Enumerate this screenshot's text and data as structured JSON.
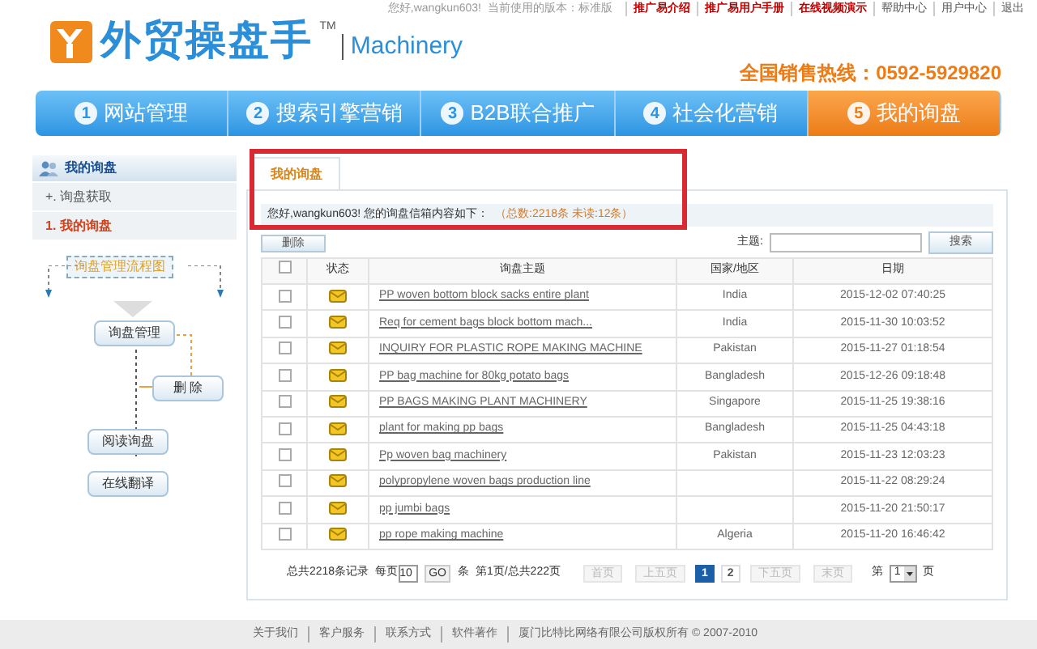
{
  "header": {
    "greeting": "您好,wangkun603!",
    "edition": "当前使用的版本：标准版",
    "links": [
      {
        "label": "推广易介绍",
        "highlight": true
      },
      {
        "label": "推广易用户手册",
        "highlight": true
      },
      {
        "label": "在线视频演示",
        "highlight": true
      },
      {
        "label": "帮助中心",
        "highlight": false
      },
      {
        "label": "用户中心",
        "highlight": false
      },
      {
        "label": "退出",
        "highlight": false
      }
    ],
    "logo_text": "外贸操盘手",
    "logo_mark": "TM",
    "logo_sub": "Machinery",
    "hotline": "全国销售热线：0592-5929820"
  },
  "nav": [
    {
      "number": "1",
      "label": "网站管理",
      "selected": false
    },
    {
      "number": "2",
      "label": "搜索引擎营销",
      "selected": false
    },
    {
      "number": "3",
      "label": "B2B联合推广",
      "selected": false
    },
    {
      "number": "4",
      "label": "社会化营销",
      "selected": false
    },
    {
      "number": "5",
      "label": "我的询盘",
      "selected": true
    }
  ],
  "sidebar": {
    "title": "我的询盘",
    "items": [
      {
        "label": "+. 询盘获取",
        "selected": false
      },
      {
        "label": "1. 我的询盘",
        "selected": true
      }
    ],
    "flow": {
      "title": "询盘管理流程图",
      "manage": "询盘管理",
      "delete": "删 除",
      "read": "阅读询盘",
      "translate": "在线翻译"
    }
  },
  "tab": {
    "label": "我的询盘"
  },
  "summary": {
    "text": "您好,wangkun603!  您的询盘信箱内容如下：",
    "counts": "（总数:2218条   未读:12条）"
  },
  "toolbar": {
    "delete": "删除",
    "search_label": "主题:",
    "search_button": "搜索"
  },
  "table": {
    "select_all_checked": false,
    "columns": [
      "状态",
      "询盘主题",
      "国家/地区",
      "日期"
    ],
    "rows": [
      {
        "checked": false,
        "unread": true,
        "subject": "PP woven bottom block sacks entire plant",
        "country": "India",
        "date": "2015-12-02 07:40:25"
      },
      {
        "checked": false,
        "unread": true,
        "subject": "Req for cement bags block bottom mach...",
        "country": "India",
        "date": "2015-11-30 10:03:52"
      },
      {
        "checked": false,
        "unread": true,
        "subject": "INQUIRY FOR PLASTIC ROPE MAKING MACHINE",
        "country": "Pakistan",
        "date": "2015-11-27 01:18:54"
      },
      {
        "checked": false,
        "unread": true,
        "subject": "PP bag machine for 80kg potato bags",
        "country": "Bangladesh",
        "date": "2015-12-26 09:18:48"
      },
      {
        "checked": false,
        "unread": true,
        "subject": "PP BAGS MAKING PLANT MACHINERY",
        "country": "Singapore",
        "date": "2015-11-25 19:38:16"
      },
      {
        "checked": false,
        "unread": true,
        "subject": "plant for making pp bags",
        "country": "Bangladesh",
        "date": "2015-11-25 04:43:18"
      },
      {
        "checked": false,
        "unread": true,
        "subject": "Pp woven bag machinery",
        "country": "Pakistan",
        "date": "2015-11-23 12:03:23"
      },
      {
        "checked": false,
        "unread": true,
        "subject": "polypropylene woven bags production line",
        "date": "2015-11-22 08:29:24"
      },
      {
        "checked": false,
        "unread": true,
        "subject": "pp jumbi bags",
        "date": "2015-11-20 21:50:17"
      },
      {
        "checked": false,
        "unread": true,
        "subject": "pp rope making machine",
        "country": "Algeria",
        "date": "2015-11-20 16:46:42"
      }
    ]
  },
  "pager": {
    "total": "总共2218条记录",
    "per_page_label": "每页",
    "per_page": "10",
    "go": "GO",
    "unit": "条",
    "page_info": "第1页/总共222页",
    "buttons": [
      {
        "label": "首页",
        "kind": "nav",
        "disabled": true
      },
      {
        "label": "上五页",
        "kind": "nav",
        "disabled": true
      },
      {
        "label": "1",
        "kind": "page",
        "selected": true
      },
      {
        "label": "2",
        "kind": "page",
        "selected": false
      },
      {
        "label": "下五页",
        "kind": "nav",
        "disabled": true
      },
      {
        "label": "末页",
        "kind": "nav",
        "disabled": true
      }
    ],
    "jump_prefix": "第",
    "jump_value": "1",
    "jump_suffix": "页"
  },
  "footer": [
    "关于我们",
    "客户服务",
    "联系方式",
    "软件著作",
    "厦门比特比网络有限公司版权所有 © 2007-2010"
  ]
}
